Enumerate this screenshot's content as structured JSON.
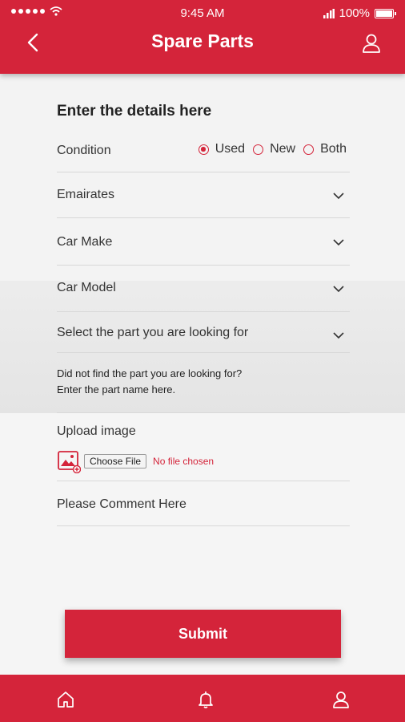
{
  "status_bar": {
    "time": "9:45 AM",
    "battery": "100%"
  },
  "header": {
    "title": "Spare Parts",
    "back_icon": "chevron-left-icon",
    "user_icon": "user-icon"
  },
  "form": {
    "heading": "Enter the details here",
    "condition": {
      "label": "Condition",
      "options": [
        "Used",
        "New",
        "Both"
      ],
      "selected": "Used"
    },
    "emirates_label": "Emairates",
    "car_make_label": "Car Make",
    "car_model_label": "Car Model",
    "part_label": "Select the part you are looking for",
    "note_line1": "Did not find the part you are looking for?",
    "note_line2": "Enter the part name here.",
    "upload_label": "Upload image",
    "choose_file": "Choose File",
    "no_file": "No file chosen",
    "comment_placeholder": "Please Comment Here"
  },
  "submit_label": "Submit",
  "footer": {
    "icons": [
      "home-icon",
      "bell-icon",
      "user-icon"
    ]
  },
  "colors": {
    "accent": "#d4243a",
    "background": "#f3f3f3"
  }
}
